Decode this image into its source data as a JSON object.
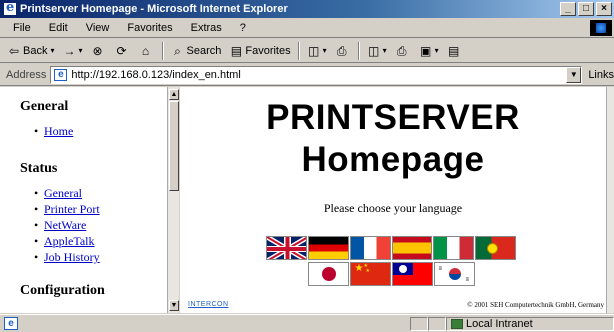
{
  "window": {
    "title": "Printserver Homepage - Microsoft Internet Explorer",
    "buttons": [
      "_",
      "□",
      "×"
    ]
  },
  "menu": [
    "File",
    "Edit",
    "View",
    "Favorites",
    "Extras",
    "?"
  ],
  "toolbar": {
    "back": "Back",
    "search": "Search",
    "favorites": "Favorites"
  },
  "address": {
    "label": "Address",
    "url": "http://192.168.0.123/index_en.html",
    "links": "Links"
  },
  "nav": {
    "sections": [
      {
        "heading": "General",
        "items": [
          "Home"
        ]
      },
      {
        "heading": "Status",
        "items": [
          "General",
          "Printer Port",
          "NetWare",
          "AppleTalk",
          "Job History"
        ]
      },
      {
        "heading": "Configuration",
        "items": []
      }
    ]
  },
  "main": {
    "title_line1": "PRINTSERVER",
    "title_line2": "Homepage",
    "prompt": "Please choose your language",
    "flags_row1": [
      "english-uk-flag",
      "german-flag",
      "french-flag",
      "spanish-flag",
      "italian-flag",
      "portuguese-flag"
    ],
    "flags_row2": [
      "japanese-flag",
      "chinese-flag",
      "taiwanese-flag",
      "korean-flag"
    ],
    "footer_left": "INTERCON",
    "footer_right": "© 2001 SEH Computertechnik GmbH, Germany"
  },
  "status": {
    "zone": "Local Intranet"
  },
  "colors": {
    "link": "#0000cc",
    "titlebar_start": "#0a246a",
    "chrome": "#d4d0c8"
  }
}
